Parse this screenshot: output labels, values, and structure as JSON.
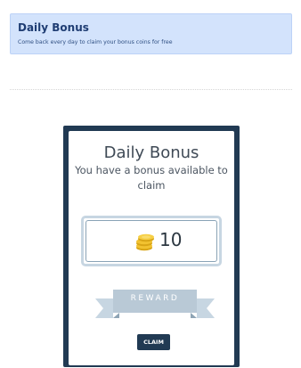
{
  "header": {
    "title": "Daily Bonus",
    "subtitle": "Come back every day to claim your bonus coins for free"
  },
  "card": {
    "title": "Daily Bonus",
    "message": "You have a bonus available to claim",
    "bonus_amount": "10",
    "ribbon_label": "REWARD",
    "claim_label": "CLAIM"
  },
  "icons": {
    "bonus": "coins-icon"
  },
  "colors": {
    "header_bg": "#d3e3fc",
    "header_title": "#1f3d73",
    "card_border": "#213a53",
    "coin": "#f2c230",
    "ribbon": "#b9c9d6"
  }
}
